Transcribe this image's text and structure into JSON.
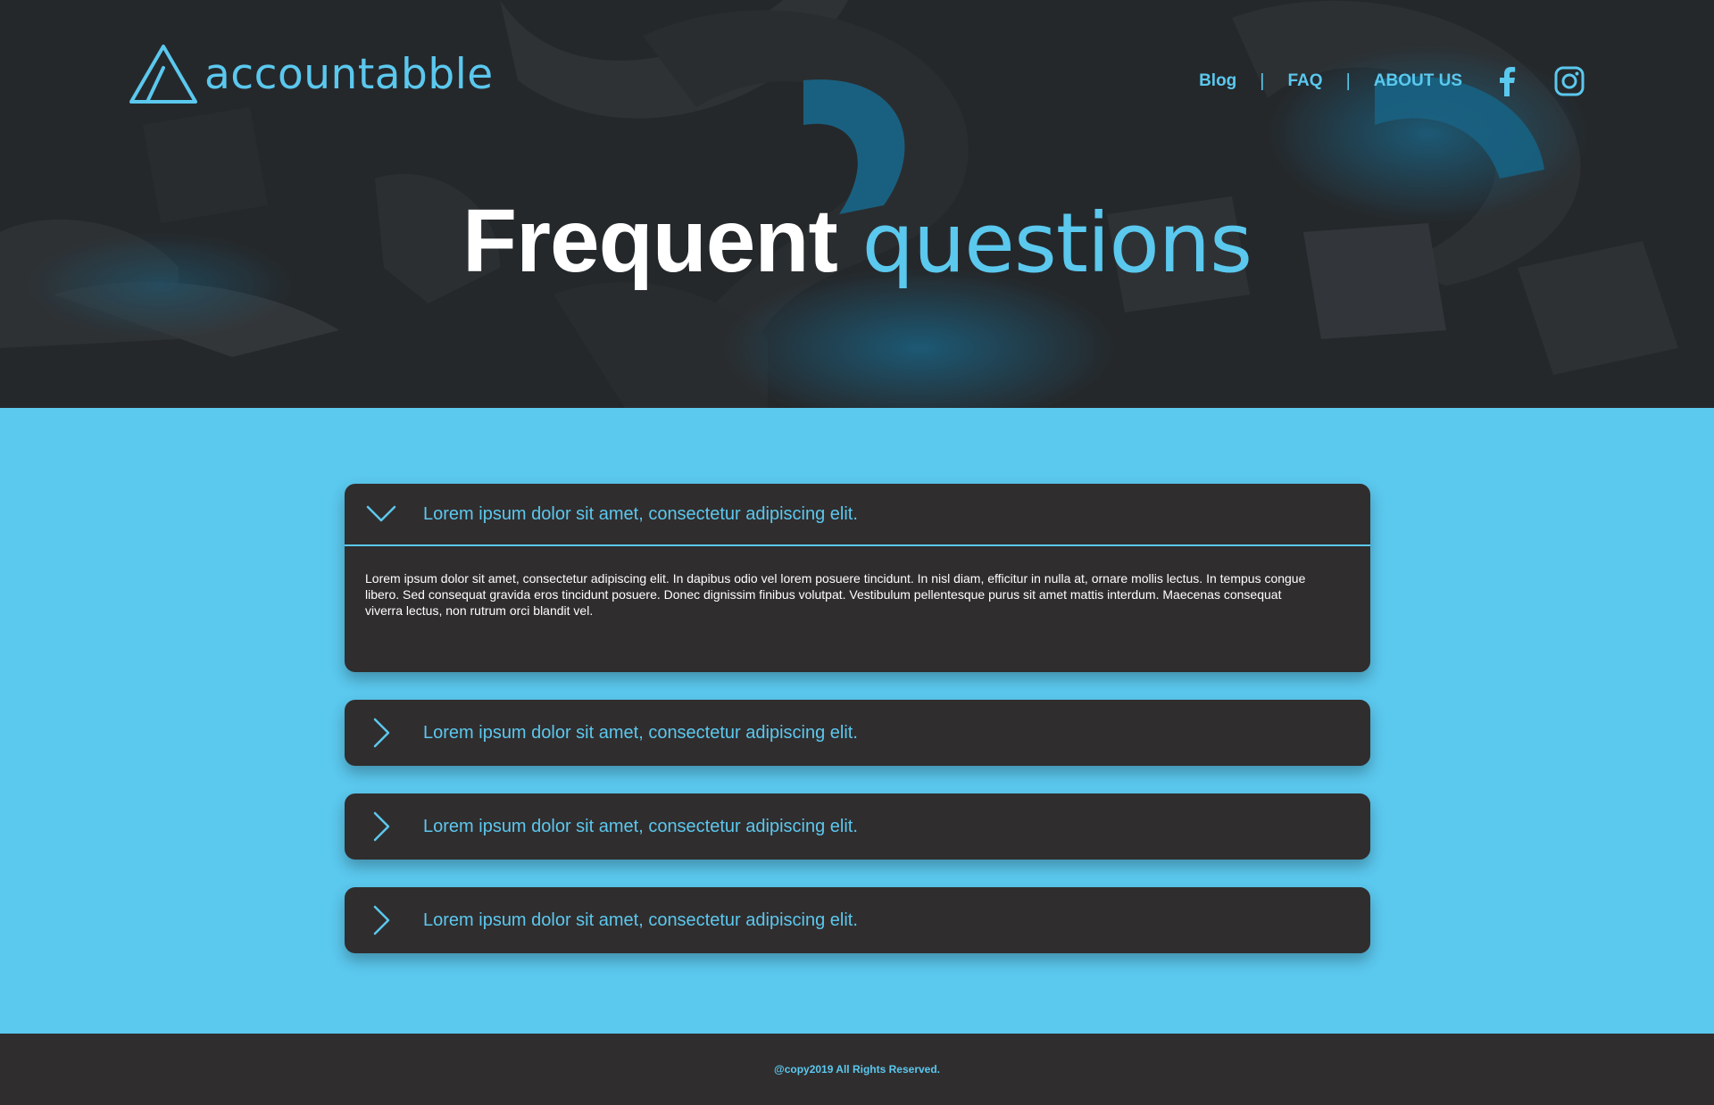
{
  "brand": {
    "name": "accountabble"
  },
  "nav": {
    "items": [
      {
        "label": "Blog"
      },
      {
        "label": "FAQ"
      },
      {
        "label": "ABOUT US"
      }
    ],
    "separator": "|",
    "social": [
      {
        "icon": "facebook-icon"
      },
      {
        "icon": "instagram-icon"
      }
    ]
  },
  "hero": {
    "title_strong": "Frequent",
    "title_light": "questions"
  },
  "faq": {
    "items": [
      {
        "question": "Lorem ipsum dolor sit amet, consectetur adipiscing elit.",
        "answer": "Lorem ipsum dolor sit amet, consectetur adipiscing elit. In dapibus odio vel lorem posuere tincidunt. In nisl diam, efficitur in nulla at, ornare mollis lectus. In tempus congue libero. Sed consequat gravida eros tincidunt posuere. Donec dignissim finibus volutpat. Vestibulum pellentesque purus sit amet mattis interdum. Maecenas consequat viverra lectus, non rutrum orci blandit vel.",
        "expanded": true,
        "icon": "chevron-down-icon"
      },
      {
        "question": "Lorem ipsum dolor sit amet, consectetur adipiscing elit.",
        "expanded": false,
        "icon": "chevron-right-icon"
      },
      {
        "question": "Lorem ipsum dolor sit amet, consectetur adipiscing elit.",
        "expanded": false,
        "icon": "chevron-right-icon"
      },
      {
        "question": "Lorem ipsum dolor sit amet, consectetur adipiscing elit.",
        "expanded": false,
        "icon": "chevron-right-icon"
      }
    ]
  },
  "footer": {
    "text": "@copy2019 All Rights Reserved."
  },
  "colors": {
    "accent": "#5bc8ee",
    "dark": "#302d2e",
    "hero_bg": "#2a2d30",
    "white": "#ffffff"
  }
}
